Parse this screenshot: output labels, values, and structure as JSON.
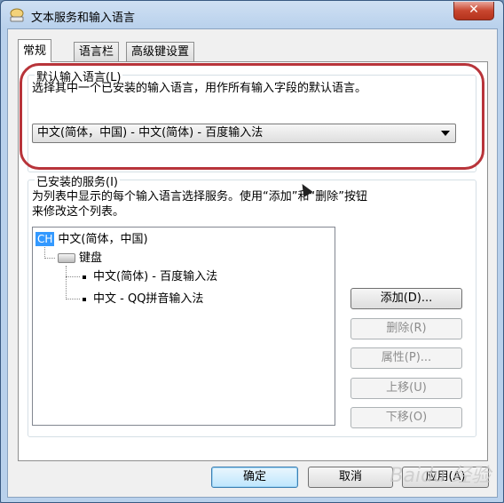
{
  "window": {
    "title": "文本服务和输入语言",
    "close_label": "✕"
  },
  "tabs": [
    {
      "label": "常规",
      "active": true
    },
    {
      "label": "语言栏",
      "active": false
    },
    {
      "label": "高级键设置",
      "active": false
    }
  ],
  "default_language": {
    "group_title": "默认输入语言(L)",
    "description": "选择其中一个已安装的输入语言，用作所有输入字段的默认语言。",
    "selected": "中文(简体，中国) - 中文(简体) - 百度输入法"
  },
  "installed_services": {
    "group_title": "已安装的服务(I)",
    "description_line1": "为列表中显示的每个输入语言选择服务。使用“添加”和“删除”按钮",
    "description_line2": "来修改这个列表。",
    "tree": {
      "language_badge": "CH",
      "language": "中文(简体，中国)",
      "category": "键盘",
      "items": [
        "中文(简体) - 百度输入法",
        "中文 - QQ拼音输入法"
      ]
    },
    "buttons": {
      "add": "添加(D)...",
      "remove": "删除(R)",
      "properties": "属性(P)...",
      "move_up": "上移(U)",
      "move_down": "下移(O)"
    }
  },
  "footer": {
    "ok": "确定",
    "cancel": "取消",
    "apply": "应用(A)"
  },
  "watermark": "Baidu 经验",
  "colors": {
    "highlight": "#b8343a",
    "selection": "#3399ff",
    "title_bar": "#b9d1ec"
  }
}
